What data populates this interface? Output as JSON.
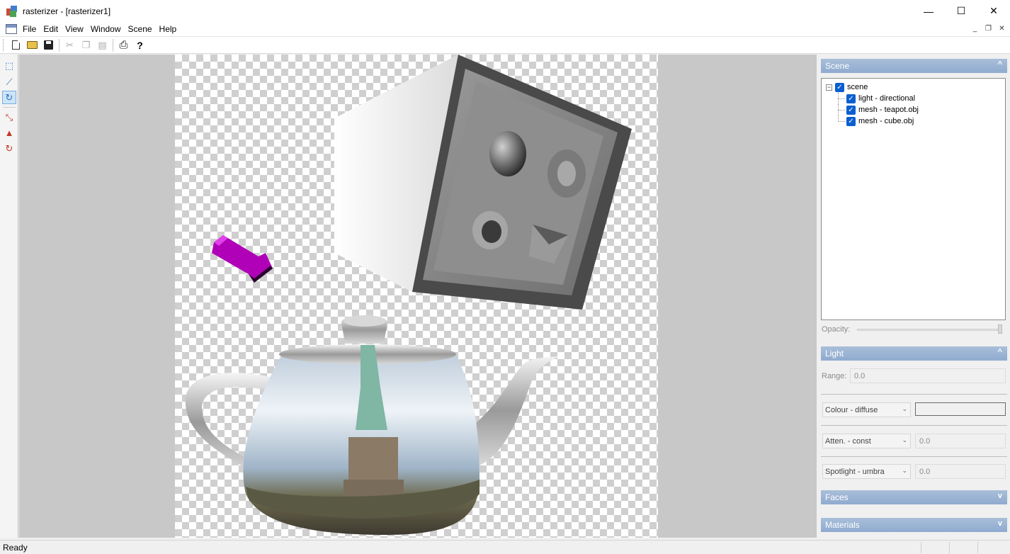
{
  "window": {
    "title": "rasterizer - [rasterizer1]",
    "controls": {
      "minimize": "—",
      "maximize": "☐",
      "close": "✕"
    }
  },
  "menu": {
    "items": [
      "File",
      "Edit",
      "View",
      "Window",
      "Scene",
      "Help"
    ],
    "mdi_controls": {
      "minimize": "_",
      "restore": "❐",
      "close": "✕"
    }
  },
  "toolbar": {
    "buttons": [
      "new",
      "open",
      "save",
      "cut",
      "copy",
      "paste",
      "print",
      "help"
    ],
    "help_glyph": "?"
  },
  "tools": [
    "select-icon",
    "perspective-icon",
    "orbit-icon",
    "move-icon",
    "light-cone-icon",
    "light-orbit-icon"
  ],
  "scene_panel": {
    "header": "Scene",
    "collapse_glyph": "^",
    "tree": {
      "root": {
        "label": "scene",
        "checked": true,
        "expander": "−"
      },
      "children": [
        {
          "label": "light - directional",
          "checked": true
        },
        {
          "label": "mesh - teapot.obj",
          "checked": true
        },
        {
          "label": "mesh - cube.obj",
          "checked": true
        }
      ]
    },
    "opacity_label": "Opacity:",
    "opacity_value": 1.0
  },
  "light_panel": {
    "header": "Light",
    "collapse_glyph": "^",
    "range_label": "Range:",
    "range_value": "0.0",
    "colour_combo": "Colour - diffuse",
    "atten_combo": "Atten. - const",
    "atten_value": "0.0",
    "spotlight_combo": "Spotlight - umbra",
    "spotlight_value": "0.0"
  },
  "faces_panel": {
    "header": "Faces",
    "expand_glyph": "v"
  },
  "materials_panel": {
    "header": "Materials",
    "expand_glyph": "v"
  },
  "status": {
    "text": "Ready"
  },
  "colors": {
    "panel_header": "#8fabcf",
    "checkbox": "#0a5fd0",
    "viewport_bg": "#c8c8c8",
    "light_arrow": "#b000b8"
  }
}
